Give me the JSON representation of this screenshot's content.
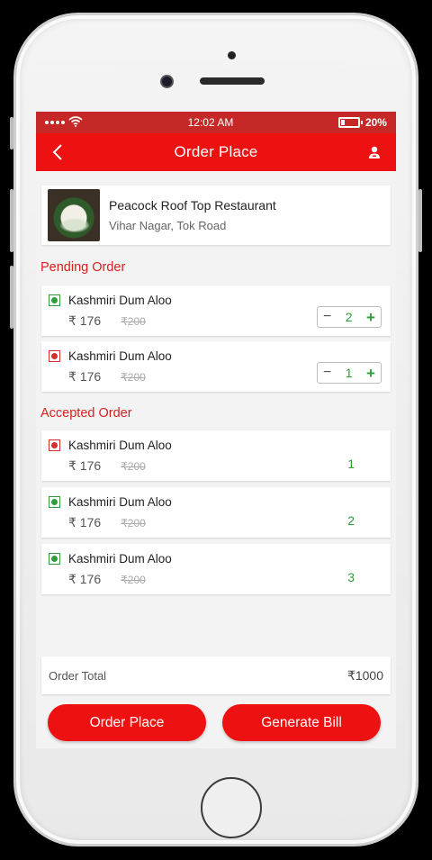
{
  "status_bar": {
    "time": "12:02 AM",
    "battery": "20%"
  },
  "nav": {
    "title": "Order Place"
  },
  "restaurant": {
    "name": "Peacock Roof Top Restaurant",
    "address": "Vihar Nagar, Tok Road"
  },
  "pending": {
    "title": "Pending Order",
    "items": [
      {
        "name": "Kashmiri Dum Aloo",
        "price": "₹ 176",
        "old_price": "₹200",
        "type": "veg",
        "qty": "2"
      },
      {
        "name": "Kashmiri Dum Aloo",
        "price": "₹ 176",
        "old_price": "₹200",
        "type": "nonveg",
        "qty": "1"
      }
    ]
  },
  "accepted": {
    "title": "Accepted Order",
    "items": [
      {
        "name": "Kashmiri Dum Aloo",
        "price": "₹ 176",
        "old_price": "₹200",
        "type": "nonveg",
        "qty": "1"
      },
      {
        "name": "Kashmiri Dum Aloo",
        "price": "₹ 176",
        "old_price": "₹200",
        "type": "veg",
        "qty": "2"
      },
      {
        "name": "Kashmiri Dum Aloo",
        "price": "₹ 176",
        "old_price": "₹200",
        "type": "veg",
        "qty": "3"
      }
    ]
  },
  "total": {
    "label": "Order Total",
    "value": "₹1000"
  },
  "buttons": {
    "order_place": "Order Place",
    "generate_bill": "Generate Bill"
  },
  "colors": {
    "primary_red": "#ee1111",
    "status_red": "#c62828",
    "veg_green": "#2e9e3a",
    "nonveg_red": "#d32f2f"
  },
  "icons": {
    "back": "chevron-left-icon",
    "profile": "user-icon",
    "wifi": "wifi-icon",
    "battery": "battery-icon"
  },
  "stepper": {
    "minus": "−",
    "plus": "+"
  }
}
